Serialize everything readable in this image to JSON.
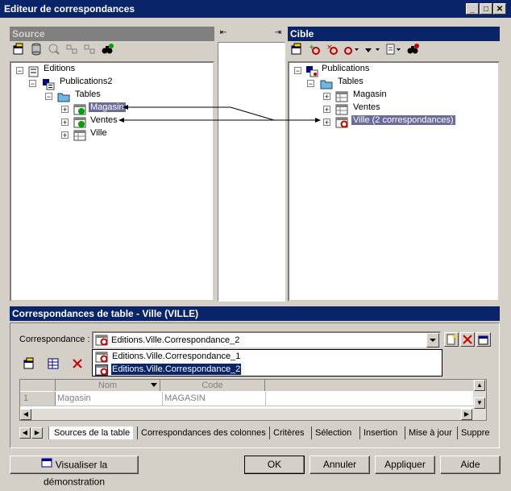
{
  "window": {
    "title": "Editeur de correspondances",
    "btn_min": "_",
    "btn_max": "□",
    "btn_close": "✕"
  },
  "source": {
    "header": "Source",
    "tree": {
      "root": "Editions",
      "publication": "Publications2",
      "tables": "Tables",
      "items": [
        "Magasin",
        "Ventes",
        "Ville"
      ]
    }
  },
  "middle": {
    "left_arrow": "⇤",
    "right_arrow": "⇥"
  },
  "target": {
    "header": "Cible",
    "tree": {
      "root": "Publications",
      "tables": "Tables",
      "items": [
        "Magasin",
        "Ventes",
        "Ville (2 correspondances)"
      ]
    }
  },
  "mapping": {
    "header": "Correspondances de table - Ville (VILLE)",
    "label": "Correspondance :",
    "selected": "Editions.Ville.Correspondance_2",
    "options": [
      "Editions.Ville.Correspondance_1",
      "Editions.Ville.Correspondance_2"
    ],
    "grid": {
      "columns": [
        "Nom",
        "Code"
      ],
      "rows": [
        {
          "num": "1",
          "nom": "Magasin",
          "code": "MAGASIN"
        }
      ]
    },
    "tabs": [
      "Sources de la table",
      "Correspondances des colonnes",
      "Critères",
      "Sélection",
      "Insertion",
      "Mise à jour",
      "Suppre"
    ]
  },
  "footer": {
    "demo": "Visualiser la démonstration",
    "ok": "OK",
    "cancel": "Annuler",
    "apply": "Appliquer",
    "help": "Aide"
  },
  "colors": {
    "titlebar": "#0a246a",
    "face": "#d4d0c8",
    "selection": "#0a246a",
    "target_selection": "#6b6b9e",
    "delete_red": "#cc0000"
  }
}
